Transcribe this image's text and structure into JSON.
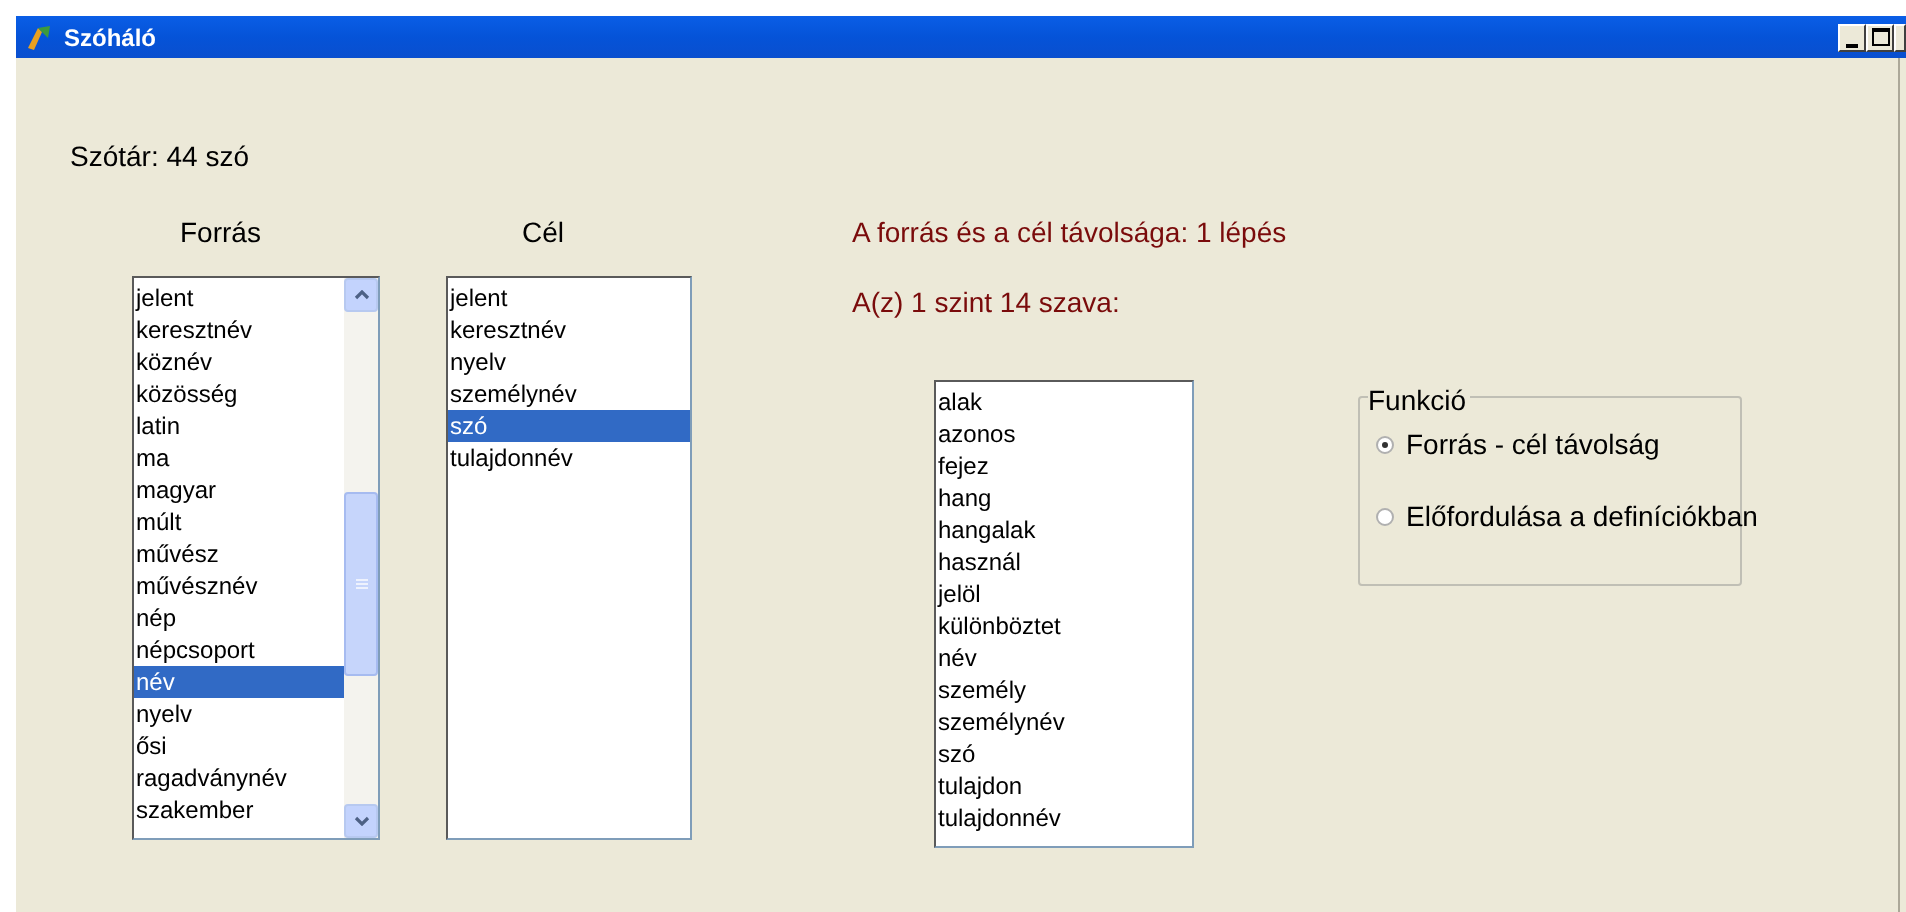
{
  "window": {
    "title": "Szóháló"
  },
  "dictionary_label": "Szótár: 44 szó",
  "source": {
    "header": "Forrás",
    "items": [
      {
        "label": "jelent",
        "selected": false
      },
      {
        "label": "keresztnév",
        "selected": false
      },
      {
        "label": "köznév",
        "selected": false
      },
      {
        "label": "közösség",
        "selected": false
      },
      {
        "label": "latin",
        "selected": false
      },
      {
        "label": "ma",
        "selected": false
      },
      {
        "label": "magyar",
        "selected": false
      },
      {
        "label": "múlt",
        "selected": false
      },
      {
        "label": "művész",
        "selected": false
      },
      {
        "label": "művésznév",
        "selected": false
      },
      {
        "label": "nép",
        "selected": false
      },
      {
        "label": "népcsoport",
        "selected": false
      },
      {
        "label": "név",
        "selected": true
      },
      {
        "label": "nyelv",
        "selected": false
      },
      {
        "label": "ősi",
        "selected": false
      },
      {
        "label": "ragadványnév",
        "selected": false
      },
      {
        "label": "szakember",
        "selected": false
      }
    ]
  },
  "target": {
    "header": "Cél",
    "items": [
      {
        "label": "jelent",
        "selected": false
      },
      {
        "label": "keresztnév",
        "selected": false
      },
      {
        "label": "nyelv",
        "selected": false
      },
      {
        "label": "személynév",
        "selected": false
      },
      {
        "label": "szó",
        "selected": true
      },
      {
        "label": "tulajdonnév",
        "selected": false
      }
    ]
  },
  "distance_text": "A forrás és a cél távolsága: 1 lépés",
  "level_text": "A(z) 1 szint 14 szava:",
  "level_words": [
    "alak",
    "azonos",
    "fejez",
    "hang",
    "hangalak",
    "használ",
    "jelöl",
    "különböztet",
    "név",
    "személy",
    "személynév",
    "szó",
    "tulajdon",
    "tulajdonnév"
  ],
  "function_group": {
    "legend": "Funkció",
    "options": [
      {
        "label": "Forrás - cél távolság",
        "selected": true
      },
      {
        "label": "Előfordulása a definíciókban",
        "selected": false
      }
    ]
  }
}
